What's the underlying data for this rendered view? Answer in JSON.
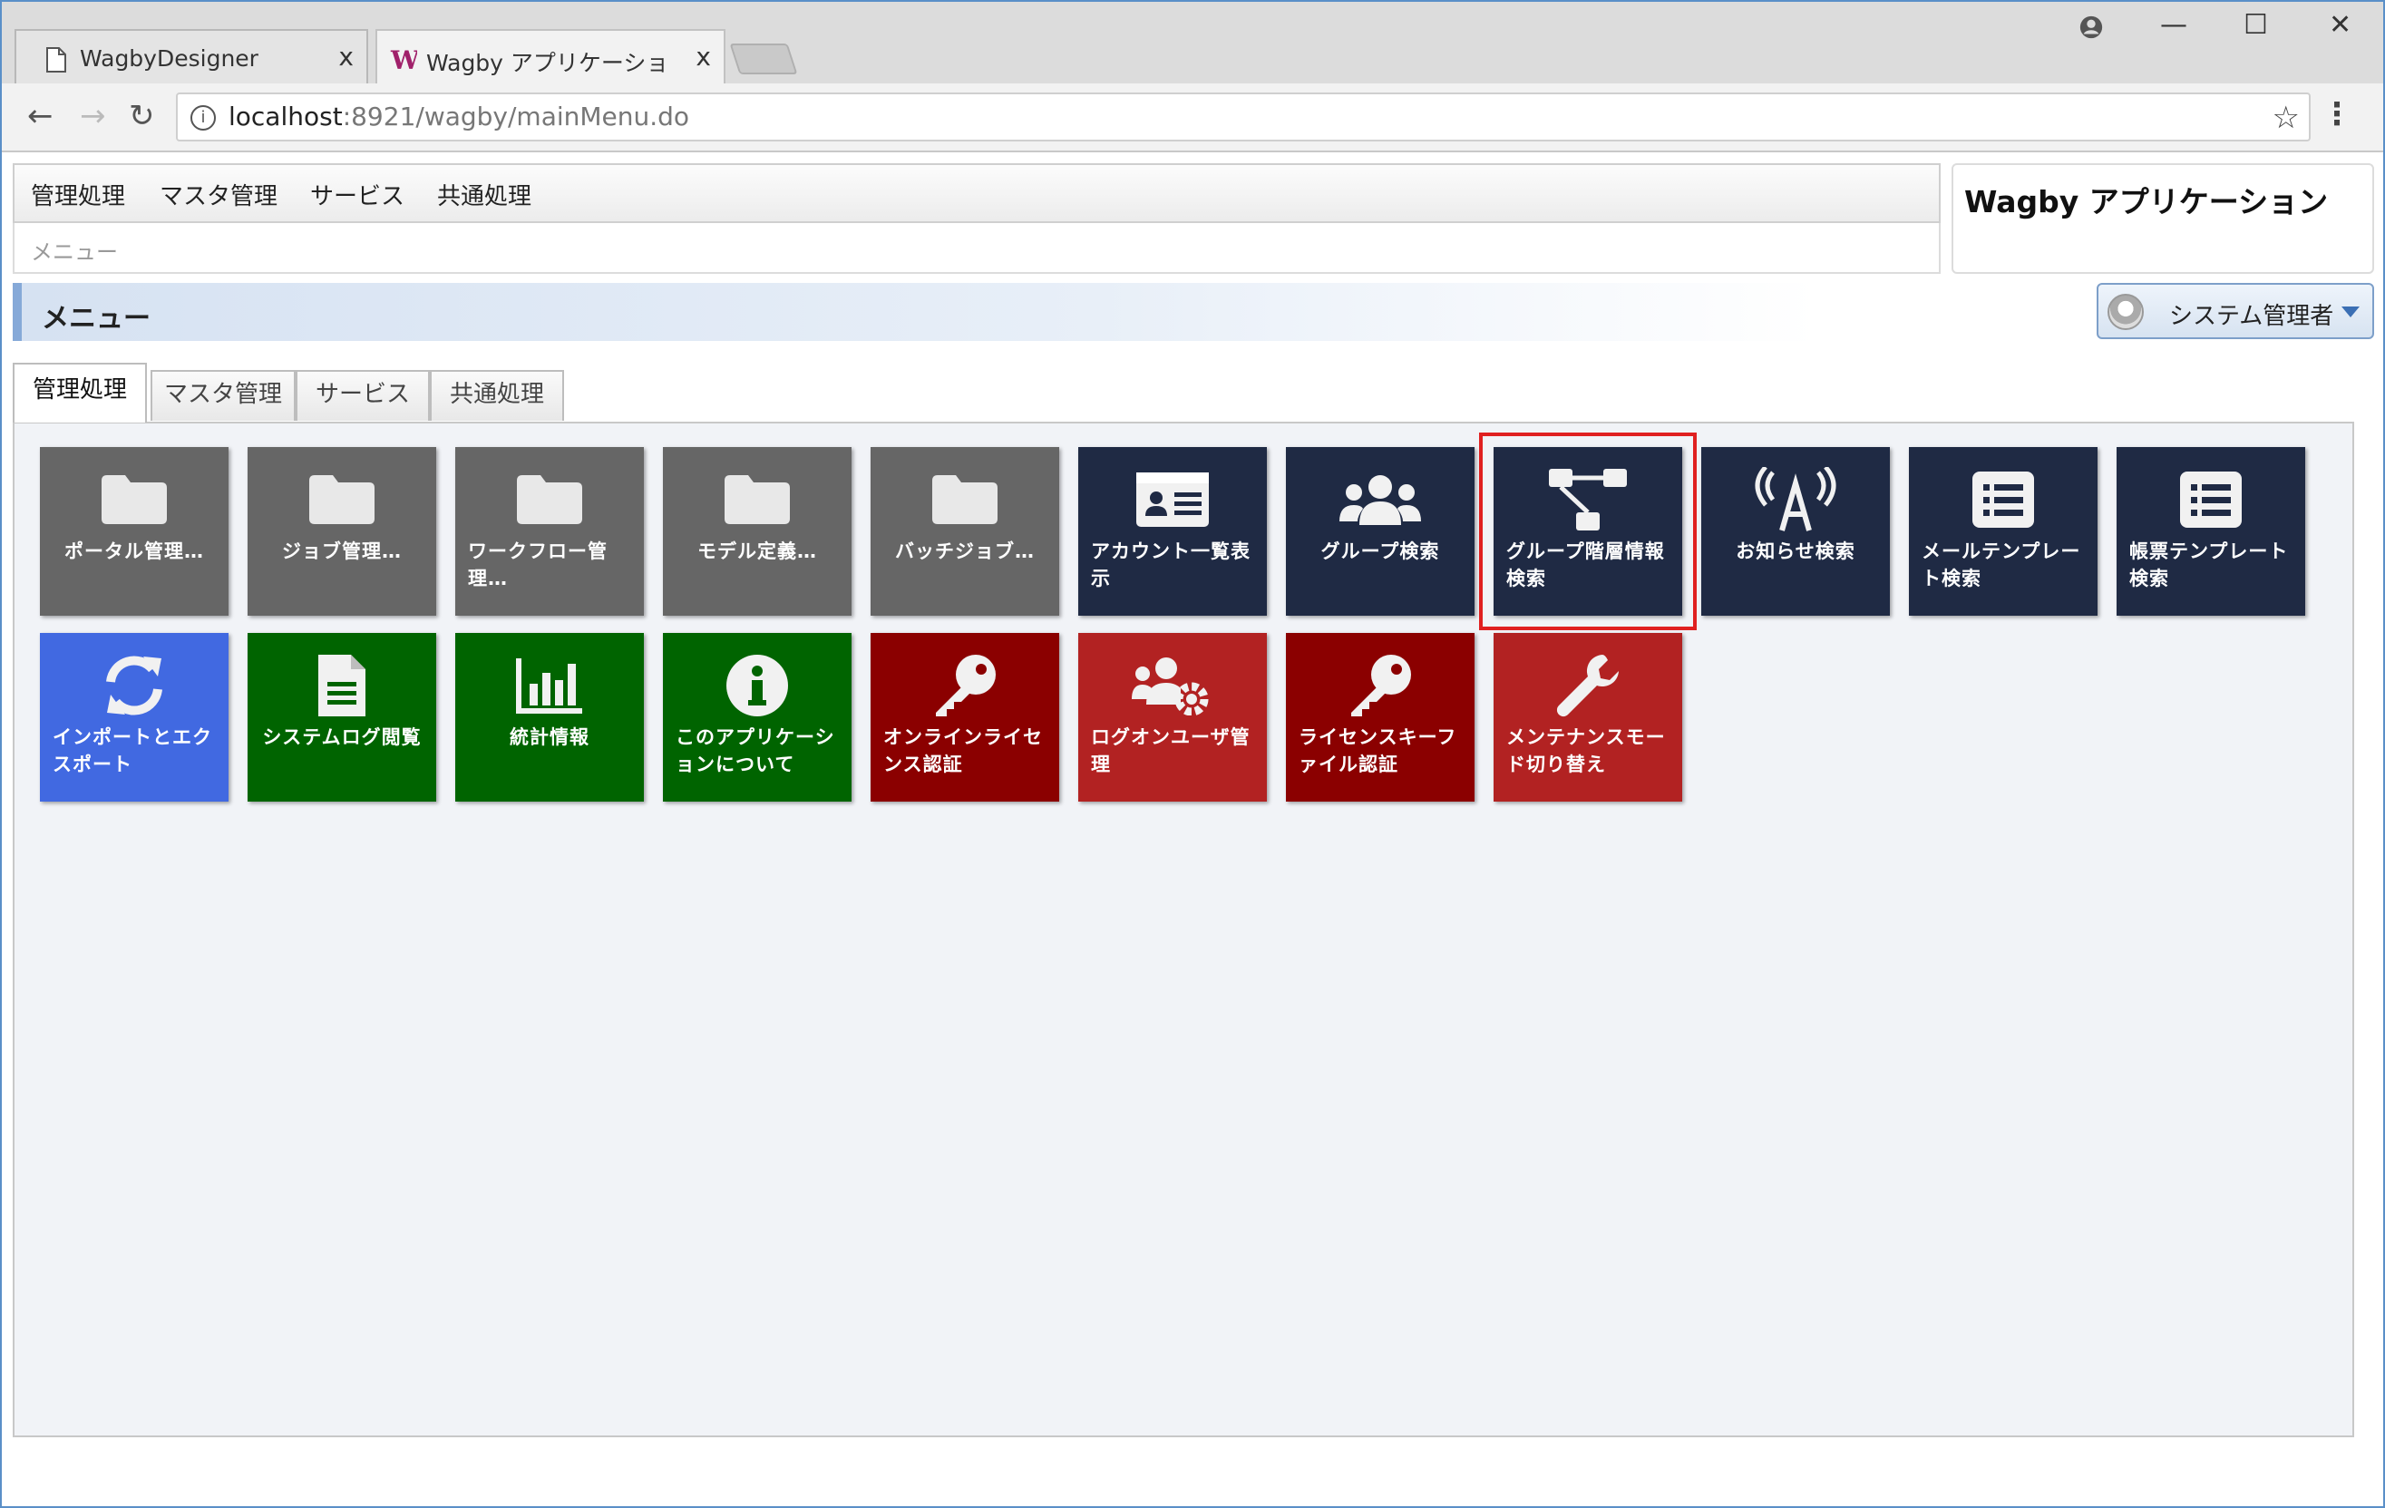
{
  "browser": {
    "tabs": [
      {
        "title": "WagbyDesigner",
        "close": "x"
      },
      {
        "title": "Wagby アプリケーション メニュー",
        "close": "x"
      }
    ],
    "url_host": "localhost",
    "url_rest": ":8921/wagby/mainMenu.do",
    "window_controls": {
      "minimize": "—",
      "maximize": "☐",
      "close": "✕"
    }
  },
  "menubar": [
    "管理処理",
    "マスタ管理",
    "サービス",
    "共通処理"
  ],
  "breadcrumb": "メニュー",
  "app_title": "Wagby アプリケーション",
  "page_title": "メニュー",
  "user": {
    "name": "システム管理者"
  },
  "tabs": [
    "管理処理",
    "マスタ管理",
    "サービス",
    "共通処理"
  ],
  "tiles": [
    {
      "label": "ポータル管理…",
      "icon": "folder-icon",
      "color": "#666666"
    },
    {
      "label": "ジョブ管理…",
      "icon": "folder-icon",
      "color": "#666666"
    },
    {
      "label": "ワークフロー管理…",
      "icon": "folder-icon",
      "color": "#666666"
    },
    {
      "label": "モデル定義…",
      "icon": "folder-icon",
      "color": "#666666"
    },
    {
      "label": "バッチジョブ…",
      "icon": "folder-icon",
      "color": "#666666"
    },
    {
      "label": "アカウント一覧表示",
      "icon": "id-card-icon",
      "color": "#1f2a44"
    },
    {
      "label": "グループ検索",
      "icon": "users-icon",
      "color": "#1f2a44"
    },
    {
      "label": "グループ階層情報検索",
      "icon": "sitemap-icon",
      "color": "#1f2a44"
    },
    {
      "label": "お知らせ検索",
      "icon": "broadcast-icon",
      "color": "#1f2a44"
    },
    {
      "label": "メールテンプレート検索",
      "icon": "list-icon",
      "color": "#1f2a44"
    },
    {
      "label": "帳票テンプレート検索",
      "icon": "list-icon",
      "color": "#1f2a44"
    },
    {
      "label": "インポートとエクスポート",
      "icon": "refresh-icon",
      "color": "#4169e1"
    },
    {
      "label": "システムログ閲覧",
      "icon": "document-icon",
      "color": "#006400"
    },
    {
      "label": "統計情報",
      "icon": "bar-chart-icon",
      "color": "#006400"
    },
    {
      "label": "このアプリケーションについて",
      "icon": "info-icon",
      "color": "#006400"
    },
    {
      "label": "オンラインライセンス認証",
      "icon": "key-icon",
      "color": "#8b0000"
    },
    {
      "label": "ログオンユーザ管理",
      "icon": "users-cog-icon",
      "color": "#b22222"
    },
    {
      "label": "ライセンスキーファイル認証",
      "icon": "key-icon",
      "color": "#8b0000"
    },
    {
      "label": "メンテナンスモード切り替え",
      "icon": "wrench-icon",
      "color": "#b22222"
    }
  ]
}
